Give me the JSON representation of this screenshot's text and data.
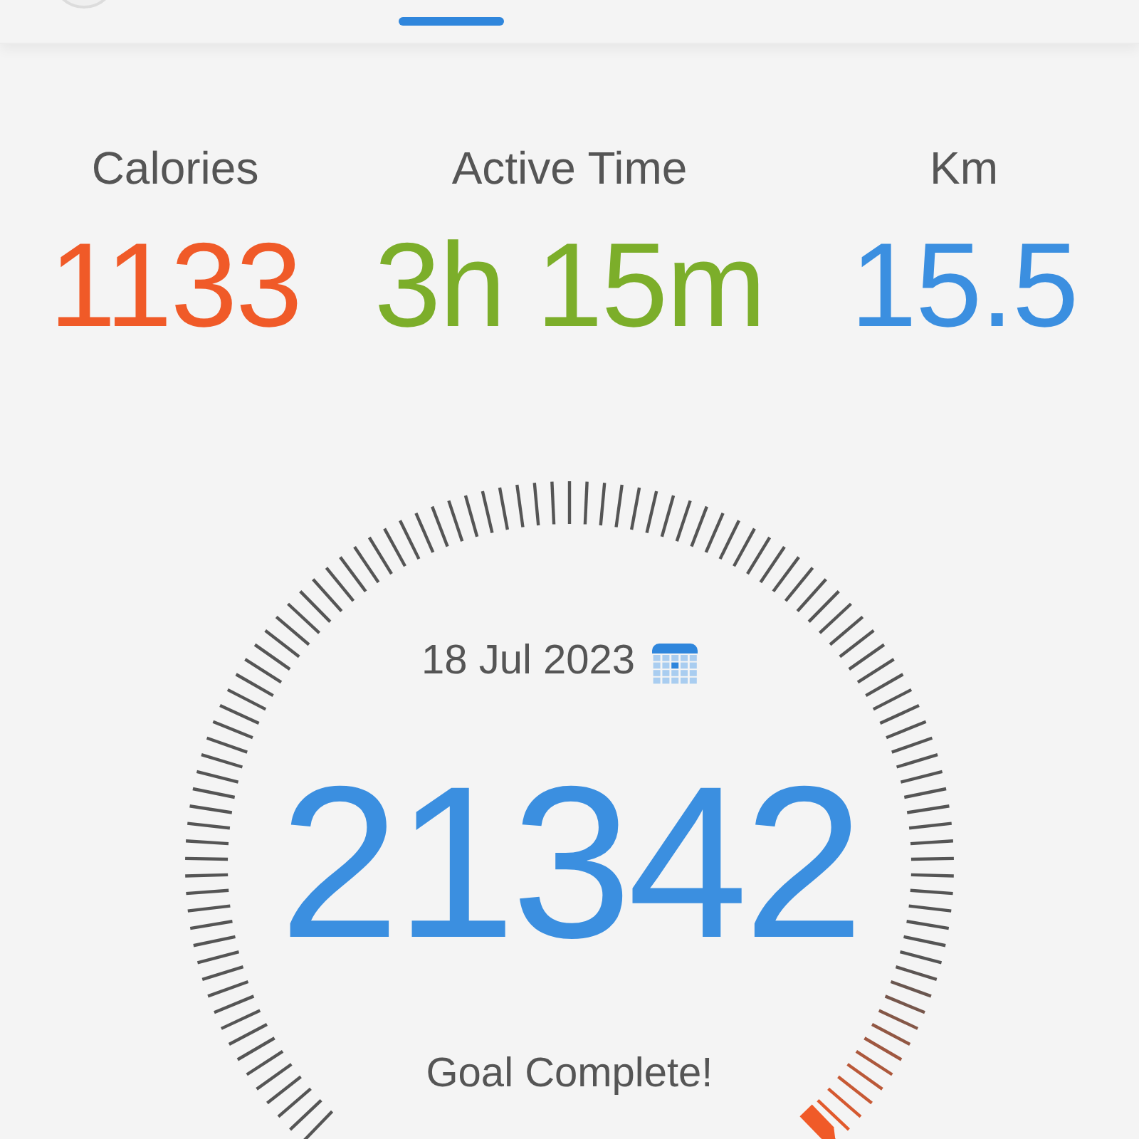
{
  "stats": [
    {
      "label": "Calories",
      "value": "1133",
      "color": "#f05a28"
    },
    {
      "label": "Active Time",
      "value": "3h 15m",
      "color": "#7cae2a"
    },
    {
      "label": "Km",
      "value": "15.5",
      "color": "#3b8fe0"
    }
  ],
  "gauge": {
    "date": "18 Jul 2023",
    "steps": "21342",
    "status": "Goal Complete!"
  }
}
